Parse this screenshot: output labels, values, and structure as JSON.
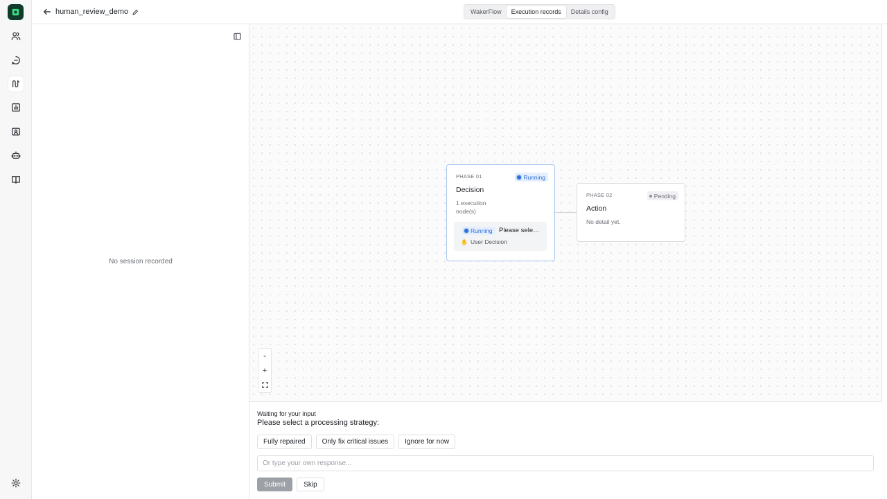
{
  "header": {
    "title": "human_review_demo",
    "tabs": [
      {
        "label": "WakerFlow",
        "active": false
      },
      {
        "label": "Execution records",
        "active": true
      },
      {
        "label": "Details config",
        "active": false
      }
    ]
  },
  "sidebar": {
    "items": [
      {
        "icon": "users-icon"
      },
      {
        "icon": "chat-icon"
      },
      {
        "icon": "workflow-icon",
        "active": true
      },
      {
        "icon": "chart-icon"
      },
      {
        "icon": "folder-user-icon"
      },
      {
        "icon": "bot-icon"
      },
      {
        "icon": "book-icon"
      },
      {
        "icon": "gear-icon"
      }
    ]
  },
  "sessions": {
    "empty_text": "No session recorded"
  },
  "canvas": {
    "nodes": [
      {
        "phase": "PHASE 01",
        "status": "Running",
        "title": "Decision",
        "subtitle": "1 execution node(s)",
        "task": {
          "status": "Running",
          "text": "Please select a processing strategy:",
          "type": "User Decision"
        }
      },
      {
        "phase": "PHASE 02",
        "status": "Pending",
        "title": "Action",
        "subtitle": "No detail yet."
      }
    ],
    "zoom": {
      "out": "-",
      "in": "+"
    }
  },
  "prompt": {
    "waiting_label": "Waiting for your input",
    "question": "Please select a processing strategy:",
    "options": [
      "Fully repaired",
      "Only fix critical issues",
      "Ignore for now"
    ],
    "response_placeholder": "Or type your own response...",
    "submit_label": "Submit",
    "skip_label": "Skip"
  },
  "colors": {
    "running": "#2b6fd8",
    "running_bg": "#e6f0fd",
    "brand": "#0f3b2a"
  }
}
